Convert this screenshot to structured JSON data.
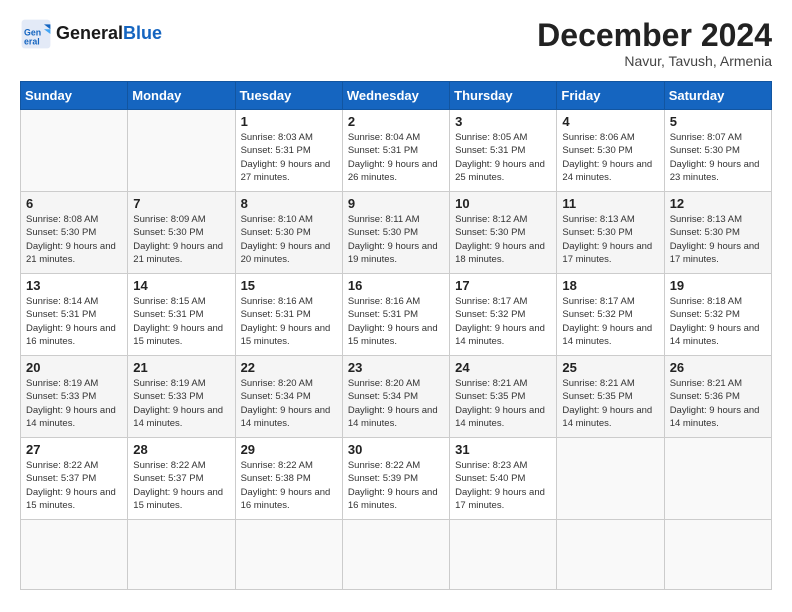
{
  "logo": {
    "text_general": "General",
    "text_blue": "Blue"
  },
  "header": {
    "month": "December 2024",
    "location": "Navur, Tavush, Armenia"
  },
  "weekdays": [
    "Sunday",
    "Monday",
    "Tuesday",
    "Wednesday",
    "Thursday",
    "Friday",
    "Saturday"
  ],
  "days": [
    null,
    null,
    {
      "n": 1,
      "sunrise": "8:03 AM",
      "sunset": "5:31 PM",
      "daylight": "9 hours and 27 minutes."
    },
    {
      "n": 2,
      "sunrise": "8:04 AM",
      "sunset": "5:31 PM",
      "daylight": "9 hours and 26 minutes."
    },
    {
      "n": 3,
      "sunrise": "8:05 AM",
      "sunset": "5:31 PM",
      "daylight": "9 hours and 25 minutes."
    },
    {
      "n": 4,
      "sunrise": "8:06 AM",
      "sunset": "5:30 PM",
      "daylight": "9 hours and 24 minutes."
    },
    {
      "n": 5,
      "sunrise": "8:07 AM",
      "sunset": "5:30 PM",
      "daylight": "9 hours and 23 minutes."
    },
    {
      "n": 6,
      "sunrise": "8:08 AM",
      "sunset": "5:30 PM",
      "daylight": "9 hours and 21 minutes."
    },
    {
      "n": 7,
      "sunrise": "8:09 AM",
      "sunset": "5:30 PM",
      "daylight": "9 hours and 21 minutes."
    },
    {
      "n": 8,
      "sunrise": "8:10 AM",
      "sunset": "5:30 PM",
      "daylight": "9 hours and 20 minutes."
    },
    {
      "n": 9,
      "sunrise": "8:11 AM",
      "sunset": "5:30 PM",
      "daylight": "9 hours and 19 minutes."
    },
    {
      "n": 10,
      "sunrise": "8:12 AM",
      "sunset": "5:30 PM",
      "daylight": "9 hours and 18 minutes."
    },
    {
      "n": 11,
      "sunrise": "8:13 AM",
      "sunset": "5:30 PM",
      "daylight": "9 hours and 17 minutes."
    },
    {
      "n": 12,
      "sunrise": "8:13 AM",
      "sunset": "5:30 PM",
      "daylight": "9 hours and 17 minutes."
    },
    {
      "n": 13,
      "sunrise": "8:14 AM",
      "sunset": "5:31 PM",
      "daylight": "9 hours and 16 minutes."
    },
    {
      "n": 14,
      "sunrise": "8:15 AM",
      "sunset": "5:31 PM",
      "daylight": "9 hours and 15 minutes."
    },
    {
      "n": 15,
      "sunrise": "8:16 AM",
      "sunset": "5:31 PM",
      "daylight": "9 hours and 15 minutes."
    },
    {
      "n": 16,
      "sunrise": "8:16 AM",
      "sunset": "5:31 PM",
      "daylight": "9 hours and 15 minutes."
    },
    {
      "n": 17,
      "sunrise": "8:17 AM",
      "sunset": "5:32 PM",
      "daylight": "9 hours and 14 minutes."
    },
    {
      "n": 18,
      "sunrise": "8:17 AM",
      "sunset": "5:32 PM",
      "daylight": "9 hours and 14 minutes."
    },
    {
      "n": 19,
      "sunrise": "8:18 AM",
      "sunset": "5:32 PM",
      "daylight": "9 hours and 14 minutes."
    },
    {
      "n": 20,
      "sunrise": "8:19 AM",
      "sunset": "5:33 PM",
      "daylight": "9 hours and 14 minutes."
    },
    {
      "n": 21,
      "sunrise": "8:19 AM",
      "sunset": "5:33 PM",
      "daylight": "9 hours and 14 minutes."
    },
    {
      "n": 22,
      "sunrise": "8:20 AM",
      "sunset": "5:34 PM",
      "daylight": "9 hours and 14 minutes."
    },
    {
      "n": 23,
      "sunrise": "8:20 AM",
      "sunset": "5:34 PM",
      "daylight": "9 hours and 14 minutes."
    },
    {
      "n": 24,
      "sunrise": "8:21 AM",
      "sunset": "5:35 PM",
      "daylight": "9 hours and 14 minutes."
    },
    {
      "n": 25,
      "sunrise": "8:21 AM",
      "sunset": "5:35 PM",
      "daylight": "9 hours and 14 minutes."
    },
    {
      "n": 26,
      "sunrise": "8:21 AM",
      "sunset": "5:36 PM",
      "daylight": "9 hours and 14 minutes."
    },
    {
      "n": 27,
      "sunrise": "8:22 AM",
      "sunset": "5:37 PM",
      "daylight": "9 hours and 15 minutes."
    },
    {
      "n": 28,
      "sunrise": "8:22 AM",
      "sunset": "5:37 PM",
      "daylight": "9 hours and 15 minutes."
    },
    {
      "n": 29,
      "sunrise": "8:22 AM",
      "sunset": "5:38 PM",
      "daylight": "9 hours and 16 minutes."
    },
    {
      "n": 30,
      "sunrise": "8:22 AM",
      "sunset": "5:39 PM",
      "daylight": "9 hours and 16 minutes."
    },
    {
      "n": 31,
      "sunrise": "8:23 AM",
      "sunset": "5:40 PM",
      "daylight": "9 hours and 17 minutes."
    },
    null,
    null,
    null,
    null
  ]
}
